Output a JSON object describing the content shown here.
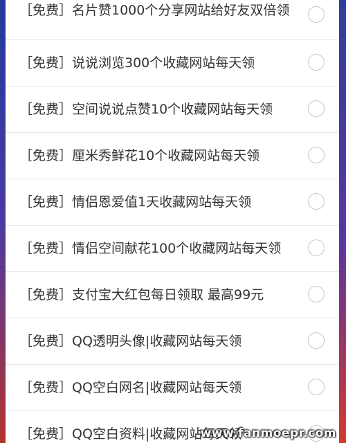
{
  "items": [
    {
      "text": "［免费］名片赞1000个分享网站给好友双倍领"
    },
    {
      "text": "［免费］说说浏览300个收藏网站每天领"
    },
    {
      "text": "［免费］空间说说点赞10个收藏网站每天领"
    },
    {
      "text": "［免费］厘米秀鲜花10个收藏网站每天领"
    },
    {
      "text": "［免费］情侣恩爱值1天收藏网站每天领"
    },
    {
      "text": "［免费］情侣空间献花100个收藏网站每天领"
    },
    {
      "text": "［免费］支付宝大红包每日领取 最高99元"
    },
    {
      "text": "［免费］QQ透明头像|收藏网站每天领"
    },
    {
      "text": "［免费］QQ空白网名|收藏网站每天领"
    },
    {
      "text": "［免费］QQ空白资料|收藏网站每天领"
    }
  ],
  "watermark": "www.fanmoepr.com",
  "colors": {
    "panel_bg": "#ffffff",
    "text": "#333333",
    "divider": "#e6e6e6",
    "radio_border": "#c8c8c8"
  }
}
